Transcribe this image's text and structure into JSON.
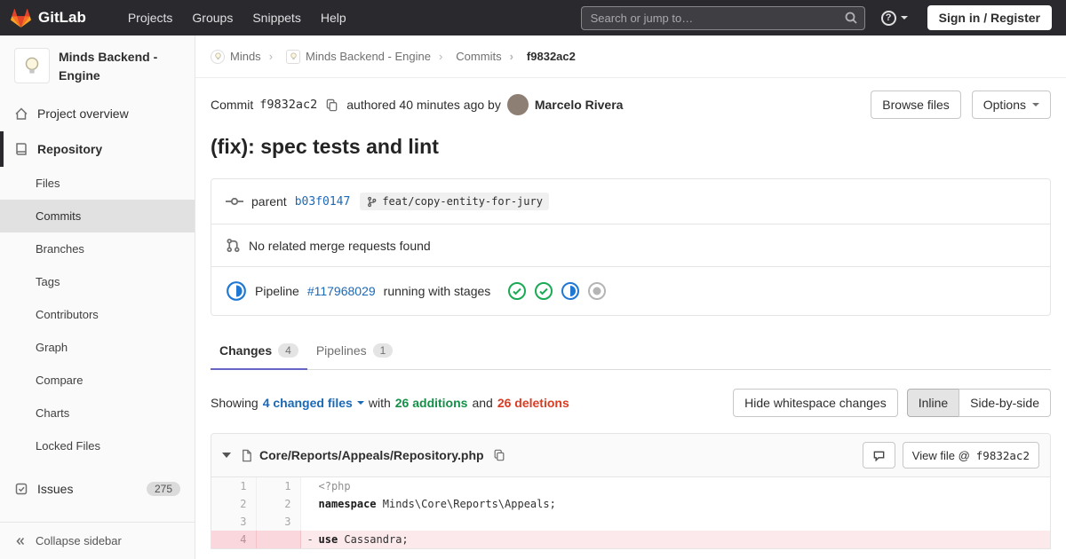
{
  "navbar": {
    "brand": "GitLab",
    "links": [
      "Projects",
      "Groups",
      "Snippets",
      "Help"
    ],
    "search_placeholder": "Search or jump to…",
    "sign_in_label": "Sign in / Register"
  },
  "sidebar": {
    "project_title": "Minds Backend - Engine",
    "overview_label": "Project overview",
    "repository_label": "Repository",
    "repo_items": [
      "Files",
      "Commits",
      "Branches",
      "Tags",
      "Contributors",
      "Graph",
      "Compare",
      "Charts",
      "Locked Files"
    ],
    "issues_label": "Issues",
    "issues_count": "275",
    "collapse_label": "Collapse sidebar"
  },
  "breadcrumb": {
    "group": "Minds",
    "project": "Minds Backend - Engine",
    "section": "Commits",
    "sha": "f9832ac2"
  },
  "commit_bar": {
    "commit_label": "Commit",
    "sha": "f9832ac2",
    "authored_text": "authored 40 minutes ago by",
    "author": "Marcelo Rivera",
    "browse_files_label": "Browse files",
    "options_label": "Options"
  },
  "commit": {
    "title": "(fix): spec tests and lint",
    "parent_label": "parent",
    "parent_sha": "b03f0147",
    "branch_ref": "feat/copy-entity-for-jury",
    "no_mr_text": "No related merge requests found",
    "pipeline_label": "Pipeline",
    "pipeline_id": "#117968029",
    "pipeline_status_text": "running with stages",
    "stages": [
      "success",
      "success",
      "running",
      "created"
    ]
  },
  "tabs": {
    "changes_label": "Changes",
    "changes_count": "4",
    "pipelines_label": "Pipelines",
    "pipelines_count": "1"
  },
  "diff_bar": {
    "showing_label": "Showing",
    "changed_files": "4 changed files",
    "with_label": "with",
    "additions": "26 additions",
    "and_label": "and",
    "deletions": "26 deletions",
    "hide_whitespace_label": "Hide whitespace changes",
    "inline_label": "Inline",
    "side_by_side_label": "Side-by-side"
  },
  "file": {
    "path": "Core/Reports/Appeals/Repository.php",
    "view_file_label": "View file @",
    "view_file_sha": "f9832ac2"
  },
  "diff": {
    "lines": [
      {
        "old": "1",
        "new": "1",
        "sign": "",
        "keyword": "",
        "code": "<?php"
      },
      {
        "old": "2",
        "new": "2",
        "sign": "",
        "keyword": "namespace",
        "code": " Minds\\Core\\Reports\\Appeals;"
      },
      {
        "old": "3",
        "new": "3",
        "sign": "",
        "keyword": "",
        "code": ""
      },
      {
        "old": "4",
        "new": "",
        "sign": "-",
        "keyword": "use",
        "code": " Cassandra;"
      }
    ]
  },
  "colors": {
    "navbar_bg": "#29292e",
    "accent": "#6666c4",
    "link": "#1b69b6",
    "success": "#1aaa55",
    "running": "#1f78d1",
    "created": "#b5b5b5",
    "additions": "#168f48",
    "deletions": "#db3b21",
    "brand_orange": "#fc6d26"
  }
}
